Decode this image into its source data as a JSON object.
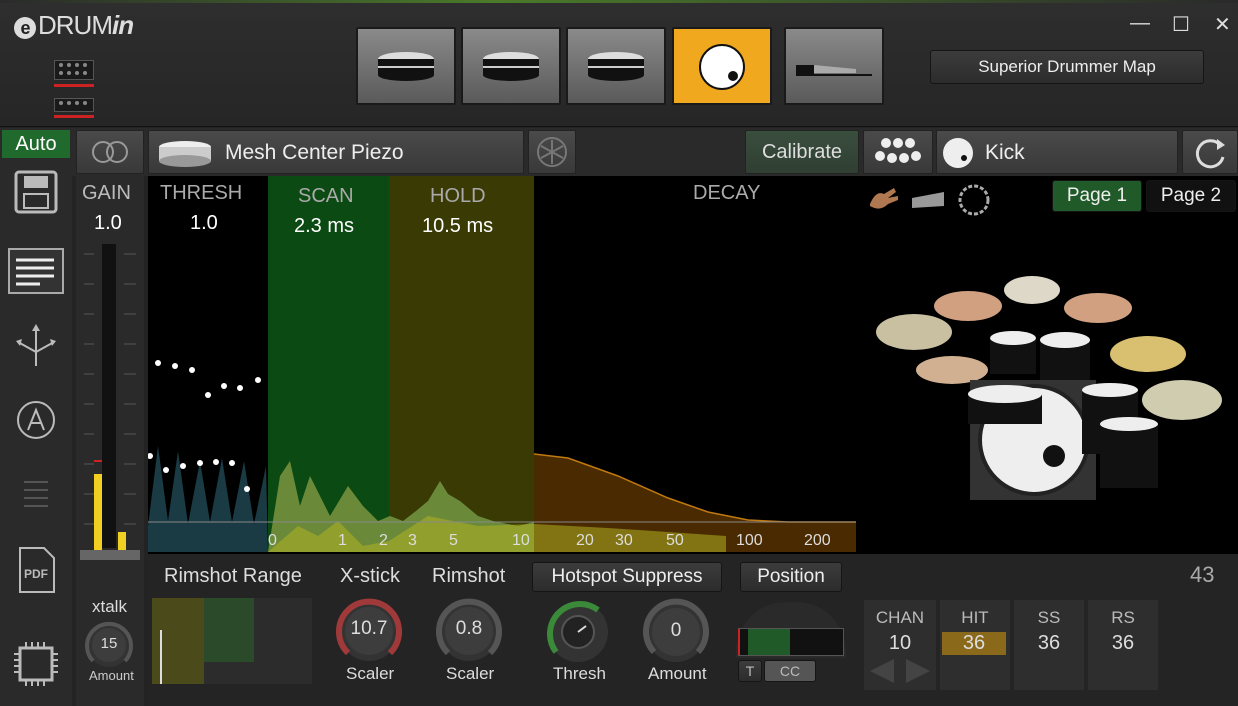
{
  "app": {
    "logo_e": "e",
    "logo_drum": "DRUM",
    "logo_in": "in",
    "window_controls": [
      "—",
      "☐",
      "✕"
    ]
  },
  "header": {
    "map_button": "Superior Drummer Map"
  },
  "toolbar": {
    "auto": "Auto",
    "pad_name": "Mesh Center Piezo",
    "calibrate": "Calibrate",
    "note_name": "Kick"
  },
  "graph": {
    "gain_label": "GAIN",
    "gain_value": "1.0",
    "thresh_label": "THRESH",
    "thresh_value": "1.0",
    "scan_label": "SCAN",
    "scan_value": "2.3 ms",
    "hold_label": "HOLD",
    "hold_value": "10.5 ms",
    "decay_label": "DECAY",
    "page1": "Page 1",
    "page2": "Page 2",
    "ticks": [
      "0",
      "1",
      "2",
      "3",
      "5",
      "10",
      "20",
      "30",
      "50",
      "100",
      "200"
    ]
  },
  "bottom": {
    "rimshot_range": "Rimshot Range",
    "xstick_label": "X-stick",
    "xstick_value": "10.7",
    "xstick_sub": "Scaler",
    "rimshot_label": "Rimshot",
    "rimshot_value": "0.8",
    "rimshot_sub": "Scaler",
    "hotspot_button": "Hotspot Suppress",
    "thresh_sub": "Thresh",
    "position_button": "Position",
    "amount_value": "0",
    "amount_sub": "Amount",
    "t_button": "T",
    "cc_button": "CC",
    "count": "43",
    "xtalk_label": "xtalk",
    "xtalk_value": "15",
    "xtalk_sub": "Amount",
    "midi": [
      {
        "label": "CHAN",
        "value": "10"
      },
      {
        "label": "HIT",
        "value": "36"
      },
      {
        "label": "SS",
        "value": "36"
      },
      {
        "label": "RS",
        "value": "36"
      }
    ]
  },
  "colors": {
    "accent_orange": "#f0a81e",
    "scan_green": "#0b4a12",
    "hold_olive": "#3a3a05",
    "auto_green": "#1f6a2c",
    "page_active": "#1f5a28"
  }
}
